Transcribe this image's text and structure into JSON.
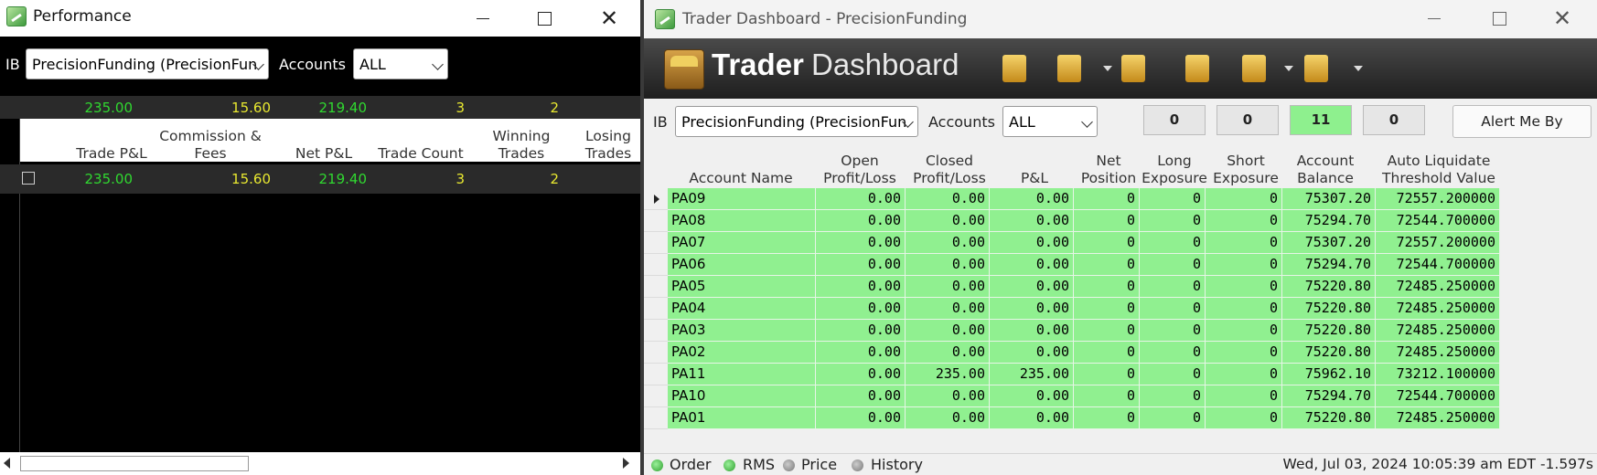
{
  "performance": {
    "title": "Performance",
    "ib_label": "IB",
    "ib_value": "PrecisionFunding (PrecisionFun",
    "accounts_label": "Accounts",
    "accounts_value": "ALL",
    "summary": {
      "trade_pnl": "235.00",
      "commission_fees": "15.60",
      "net_pnl": "219.40",
      "trade_count": "3",
      "winning_trades": "2"
    },
    "columns": {
      "trade_pnl": "Trade P&L",
      "commission_fees": "Commission & Fees",
      "net_pnl": "Net P&L",
      "trade_count": "Trade Count",
      "winning_trades": "Winning Trades",
      "losing_trades": "Losing Trades"
    },
    "row": {
      "trade_pnl": "235.00",
      "commission_fees": "15.60",
      "net_pnl": "219.40",
      "trade_count": "3",
      "winning_trades": "2"
    }
  },
  "dashboard": {
    "title": "Trader Dashboard - PrecisionFunding",
    "logo_part1": "Trader",
    "logo_part2": "Dashboard",
    "toolbar_icons": [
      "add-account-icon",
      "keys-icon",
      "settings-gears-icon",
      "folder-icon",
      "template-icon",
      "clipboard-icon"
    ],
    "ib_label": "IB",
    "ib_value": "PrecisionFunding (PrecisionFun",
    "accounts_label": "Accounts",
    "accounts_value": "ALL",
    "counters": [
      "0",
      "0",
      "11",
      "0"
    ],
    "alert_button": "Alert Me By",
    "columns": {
      "account_name": "Account Name",
      "open_pl": "Open Profit/Loss",
      "closed_pl": "Closed Profit/Loss",
      "pnl": "P&L",
      "net_position": "Net Position",
      "long_exposure": "Long Exposure",
      "short_exposure": "Short Exposure",
      "account_balance": "Account Balance",
      "auto_liquidate": "Auto Liquidate Threshold Value"
    },
    "rows": [
      [
        "PA09",
        "0.00",
        "0.00",
        "0.00",
        "0",
        "0",
        "0",
        "75307.20",
        "72557.200000"
      ],
      [
        "PA08",
        "0.00",
        "0.00",
        "0.00",
        "0",
        "0",
        "0",
        "75294.70",
        "72544.700000"
      ],
      [
        "PA07",
        "0.00",
        "0.00",
        "0.00",
        "0",
        "0",
        "0",
        "75307.20",
        "72557.200000"
      ],
      [
        "PA06",
        "0.00",
        "0.00",
        "0.00",
        "0",
        "0",
        "0",
        "75294.70",
        "72544.700000"
      ],
      [
        "PA05",
        "0.00",
        "0.00",
        "0.00",
        "0",
        "0",
        "0",
        "75220.80",
        "72485.250000"
      ],
      [
        "PA04",
        "0.00",
        "0.00",
        "0.00",
        "0",
        "0",
        "0",
        "75220.80",
        "72485.250000"
      ],
      [
        "PA03",
        "0.00",
        "0.00",
        "0.00",
        "0",
        "0",
        "0",
        "75220.80",
        "72485.250000"
      ],
      [
        "PA02",
        "0.00",
        "0.00",
        "0.00",
        "0",
        "0",
        "0",
        "75220.80",
        "72485.250000"
      ],
      [
        "PA11",
        "0.00",
        "235.00",
        "235.00",
        "0",
        "0",
        "0",
        "75962.10",
        "73212.100000"
      ],
      [
        "PA10",
        "0.00",
        "0.00",
        "0.00",
        "0",
        "0",
        "0",
        "75294.70",
        "72544.700000"
      ],
      [
        "PA01",
        "0.00",
        "0.00",
        "0.00",
        "0",
        "0",
        "0",
        "75220.80",
        "72485.250000"
      ]
    ],
    "status": {
      "items": [
        "Order",
        "RMS",
        "Price",
        "History"
      ],
      "states": [
        "on",
        "on",
        "off",
        "off"
      ],
      "timestamp": "Wed, Jul 03, 2024 10:05:39 am EDT -1.597s"
    },
    "colors": {
      "row_green": "#90f090",
      "counter_green": "#8ef08e",
      "profit_green": "#30d830",
      "value_yellow": "#e8e830"
    }
  }
}
